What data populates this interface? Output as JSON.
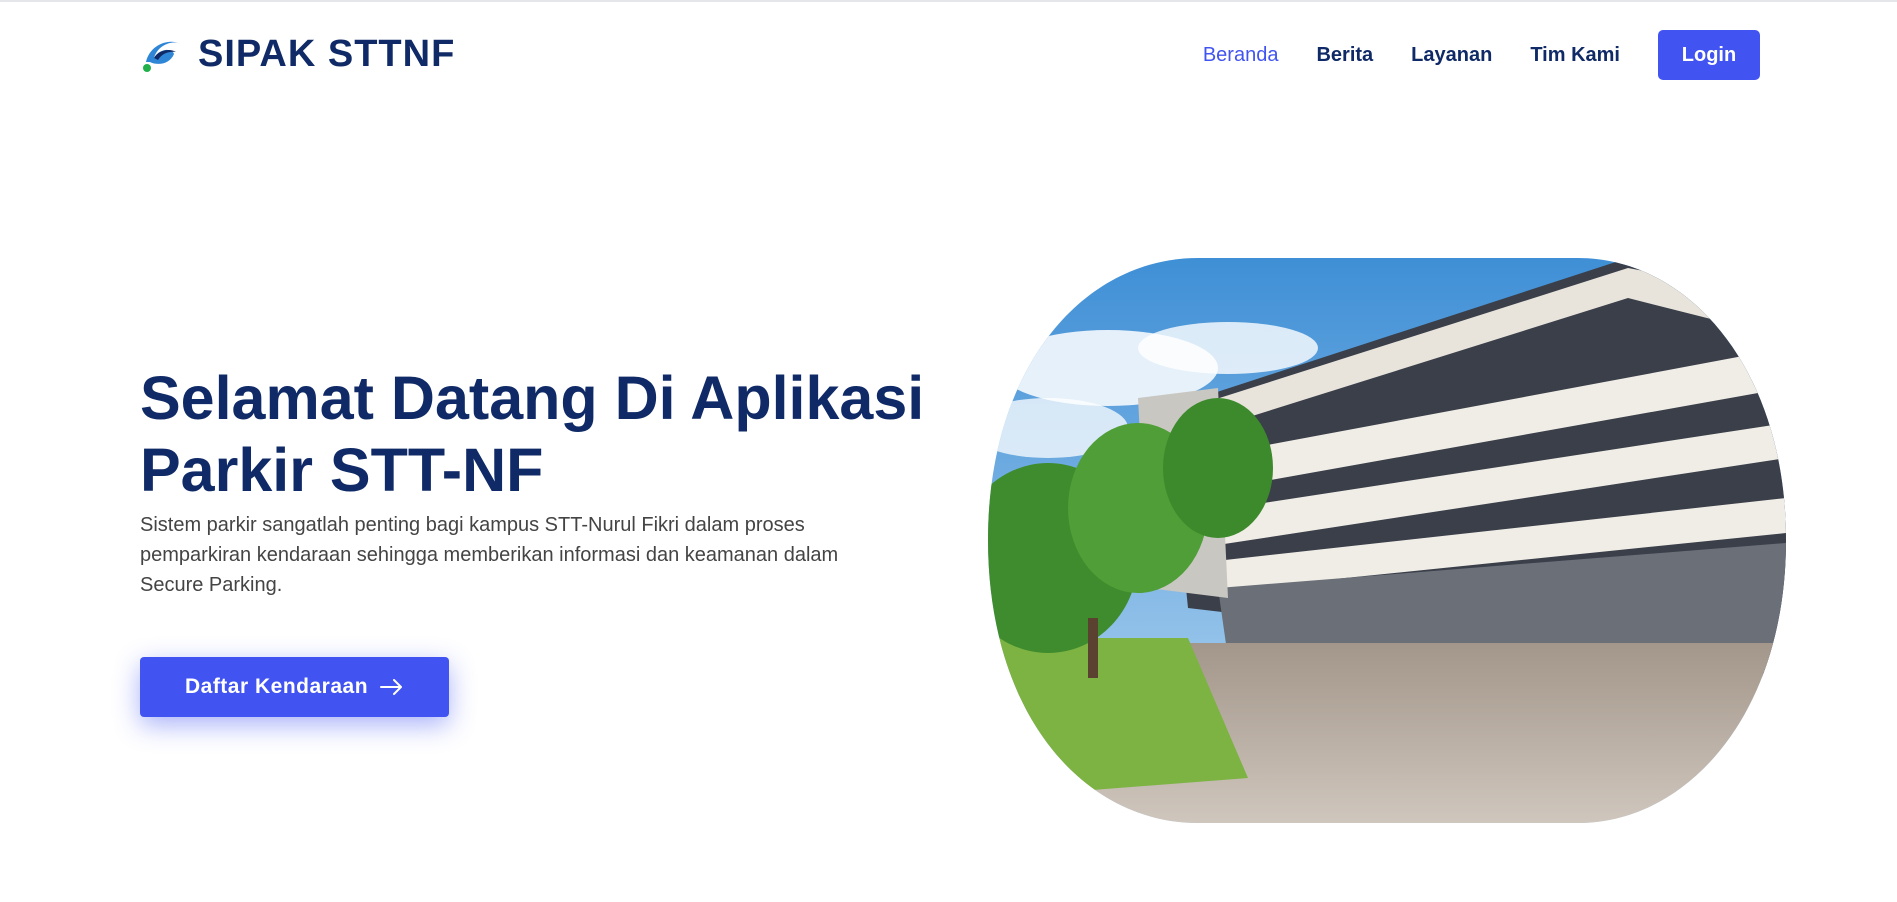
{
  "brand": {
    "name": "SIPAK STTNF",
    "logo_icon": "swoosh-logo-icon"
  },
  "nav": {
    "items": [
      {
        "label": "Beranda",
        "active": true
      },
      {
        "label": "Berita",
        "active": false
      },
      {
        "label": "Layanan",
        "active": false
      },
      {
        "label": "Tim Kami",
        "active": false
      }
    ],
    "login_label": "Login"
  },
  "hero": {
    "title": "Selamat Datang Di Aplikasi Parkir STT-NF",
    "description": "Sistem parkir sangatlah penting bagi kampus STT-Nurul Fikri dalam proses pemparkiran kendaraan sehingga memberikan informasi dan keamanan dalam Secure Parking.",
    "cta_label": "Daftar Kendaraan",
    "cta_icon": "arrow-right-icon",
    "image": "campus-building-photo"
  },
  "colors": {
    "primary": "#4154f1",
    "navy": "#0f2a66",
    "text": "#444444"
  }
}
